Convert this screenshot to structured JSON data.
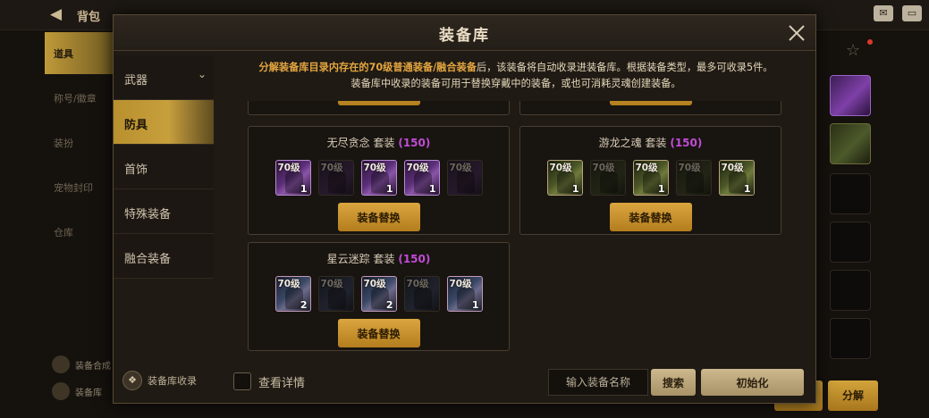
{
  "background": {
    "title": "背包",
    "sidebar": [
      "道具",
      "称号/徽章",
      "装扮",
      "宠物封印",
      "仓库"
    ],
    "bottom_labels": [
      "装备合成",
      "装备库"
    ],
    "decompose_label": "分解"
  },
  "modal": {
    "title": "装备库",
    "notice_part1": "分解装备库目录内存在的70级普通装备/融合装备",
    "notice_part2": "后，该装备将自动收录进装备库。根据装备类型，最多可收录5件。",
    "notice_line2": "装备库中收录的装备可用于替换穿戴中的装备，或也可消耗灵魂创建装备。",
    "categories": [
      {
        "label": "武器",
        "active": false,
        "chevron": true
      },
      {
        "label": "防具",
        "active": true
      },
      {
        "label": "首饰",
        "active": false
      },
      {
        "label": "特殊装备",
        "active": false
      },
      {
        "label": "融合装备",
        "active": false
      }
    ],
    "collect_label": "装备库收录",
    "sets": [
      {
        "name": "无尽贪念",
        "tag": "套装",
        "count": "(150)",
        "theme": "purple",
        "button": "装备替换",
        "slots": [
          {
            "level": "70级",
            "qty": "1",
            "owned": true
          },
          {
            "level": "70级",
            "qty": "",
            "owned": false
          },
          {
            "level": "70级",
            "qty": "1",
            "owned": true
          },
          {
            "level": "70级",
            "qty": "1",
            "owned": true
          },
          {
            "level": "70级",
            "qty": "",
            "owned": false
          }
        ]
      },
      {
        "name": "游龙之魂",
        "tag": "套装",
        "count": "(150)",
        "theme": "green",
        "button": "装备替换",
        "slots": [
          {
            "level": "70级",
            "qty": "1",
            "owned": true
          },
          {
            "level": "70级",
            "qty": "",
            "owned": false
          },
          {
            "level": "70级",
            "qty": "1",
            "owned": true
          },
          {
            "level": "70级",
            "qty": "",
            "owned": false
          },
          {
            "level": "70级",
            "qty": "1",
            "owned": true
          }
        ]
      },
      {
        "name": "星云迷踪",
        "tag": "套装",
        "count": "(150)",
        "theme": "blue",
        "button": "装备替换",
        "slots": [
          {
            "level": "70级",
            "qty": "2",
            "owned": true
          },
          {
            "level": "70级",
            "qty": "",
            "owned": false
          },
          {
            "level": "70级",
            "qty": "2",
            "owned": true
          },
          {
            "level": "70级",
            "qty": "",
            "owned": false
          },
          {
            "level": "70级",
            "qty": "1",
            "owned": true
          }
        ]
      }
    ],
    "details_label": "查看详情",
    "search_placeholder": "输入装备名称",
    "search_button": "搜索",
    "reset_button": "初始化"
  }
}
